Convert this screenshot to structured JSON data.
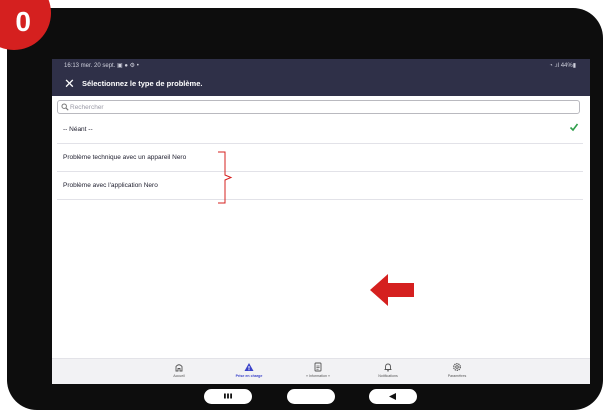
{
  "badge": {
    "number": "0"
  },
  "status_bar": {
    "left_text": "16:13  mer. 20 sept.  ▣ ● ⚙ •",
    "right_text": "◔ .ıl 44%▮"
  },
  "header": {
    "close_icon": "close-icon",
    "title": "Sélectionnez le type de problème."
  },
  "search": {
    "placeholder": "Rechercher",
    "value": ""
  },
  "options": [
    {
      "label": "-- Néant --",
      "selected": true
    },
    {
      "label": "Problème technique avec un appareil Nero",
      "selected": false
    },
    {
      "label": "Problème avec l'application Nero",
      "selected": false
    }
  ],
  "bottom_nav": [
    {
      "label": "Accueil",
      "icon": "home-icon",
      "active": false
    },
    {
      "label": "Prise en charge",
      "icon": "warning-icon",
      "active": true
    },
    {
      "label": "« Information »",
      "icon": "document-icon",
      "active": false
    },
    {
      "label": "Notifications",
      "icon": "bell-icon",
      "active": false
    },
    {
      "label": "Paramètres",
      "icon": "gear-icon",
      "active": false
    }
  ],
  "colors": {
    "header_bg": "#2f3048",
    "accent": "#3a42c9",
    "annotation": "#d5201f",
    "check": "#2e9e4a"
  },
  "system_nav": [
    "recents-icon",
    "home-pill-icon",
    "back-icon"
  ]
}
